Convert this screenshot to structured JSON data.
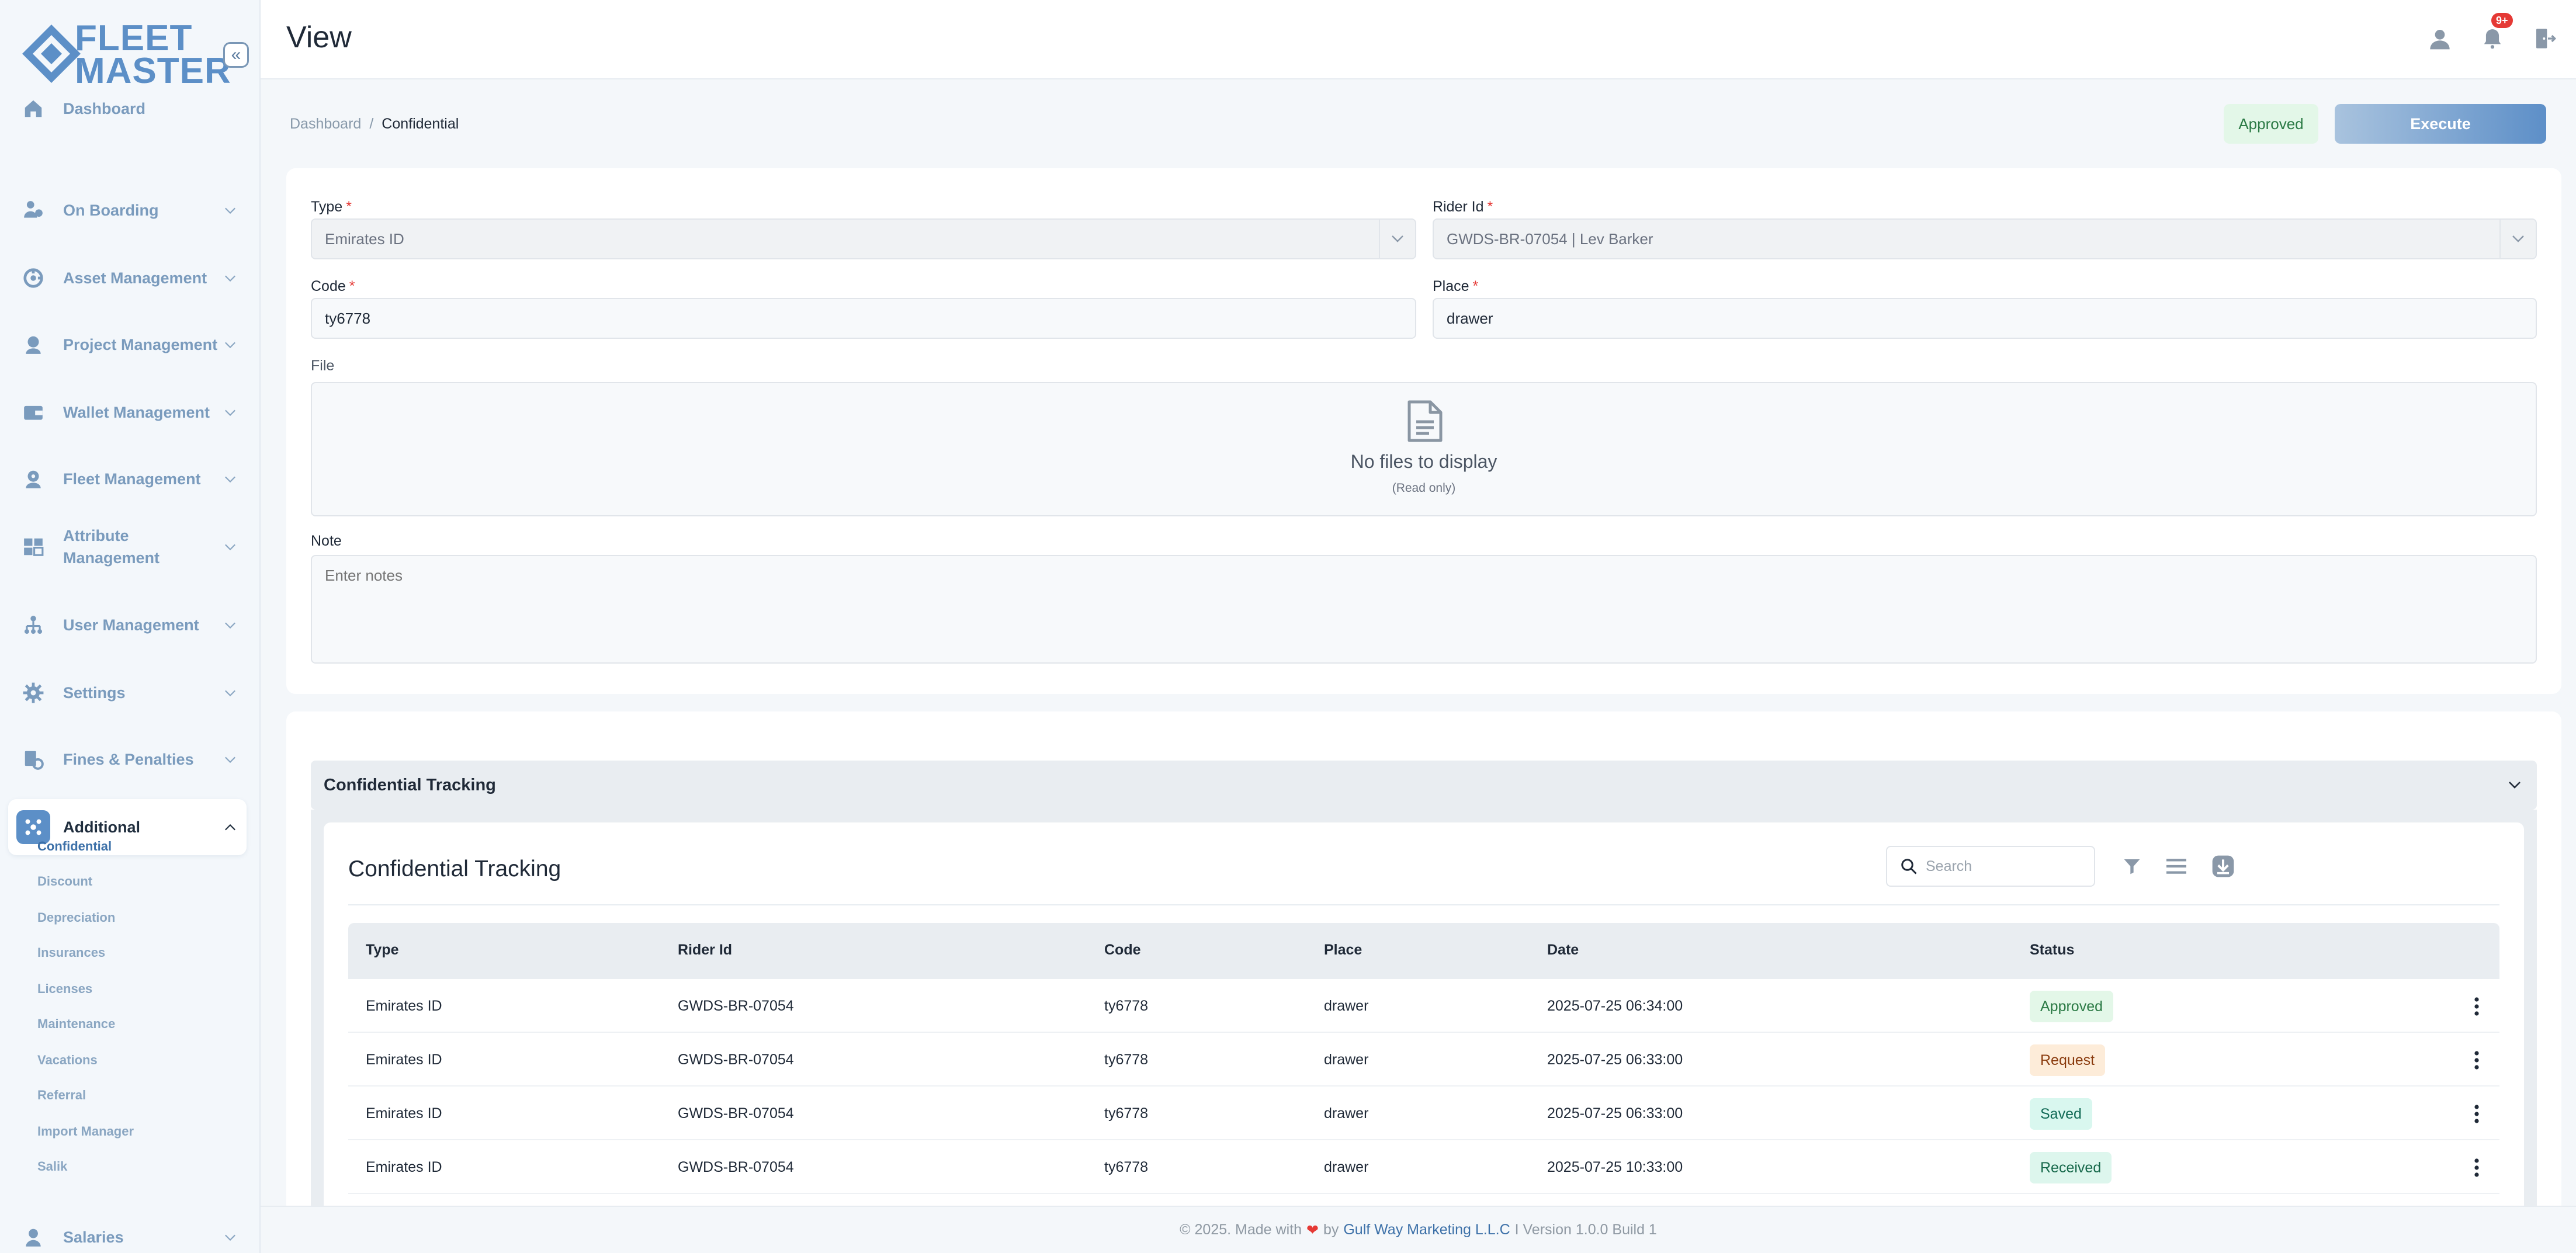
{
  "brand": {
    "line1": "FLEET",
    "line2": "MASTER",
    "color": "#5c8fc7"
  },
  "sidebar": {
    "items": [
      {
        "label": "Dashboard",
        "icon": "home-icon"
      },
      {
        "label": "On Boarding",
        "icon": "onboarding-icon"
      },
      {
        "label": "Asset Management",
        "icon": "asset-icon"
      },
      {
        "label": "Project Management",
        "icon": "project-icon"
      },
      {
        "label": "Wallet Management",
        "icon": "wallet-icon"
      },
      {
        "label": "Fleet Management",
        "icon": "fleet-icon"
      },
      {
        "label": "Attribute Management",
        "icon": "attribute-icon"
      },
      {
        "label": "User Management",
        "icon": "users-icon"
      },
      {
        "label": "Settings",
        "icon": "gear-icon"
      },
      {
        "label": "Fines & Penalties",
        "icon": "fines-icon"
      },
      {
        "label": "Additional",
        "icon": "additional-icon"
      },
      {
        "label": "Salaries",
        "icon": "salaries-icon"
      }
    ],
    "sub_items": [
      "Confidential",
      "Discount",
      "Depreciation",
      "Insurances",
      "Licenses",
      "Maintenance",
      "Vacations",
      "Referral",
      "Import Manager",
      "Salik"
    ]
  },
  "header": {
    "title": "View",
    "notifications": "9+"
  },
  "breadcrumb": {
    "root": "Dashboard",
    "sep": "/",
    "current": "Confidential"
  },
  "actions": {
    "status": "Approved",
    "execute": "Execute"
  },
  "form": {
    "type_label": "Type",
    "type_value": "Emirates ID",
    "rider_label": "Rider Id",
    "rider_value": "GWDS-BR-07054 | Lev Barker",
    "code_label": "Code",
    "code_value": "ty6778",
    "place_label": "Place",
    "place_value": "drawer",
    "file_label": "File",
    "file_empty": "No files to display",
    "file_readonly": "(Read only)",
    "note_label": "Note",
    "note_placeholder": "Enter notes",
    "required_mark": "*"
  },
  "tracking": {
    "accordion_title": "Confidential Tracking",
    "title": "Confidential Tracking",
    "search_placeholder": "Search",
    "columns": [
      "Type",
      "Rider Id",
      "Code",
      "Place",
      "Date",
      "Status"
    ],
    "rows": [
      {
        "type": "Emirates ID",
        "rider": "GWDS-BR-07054",
        "code": "ty6778",
        "place": "drawer",
        "date": "2025-07-25 06:34:00",
        "status": "Approved"
      },
      {
        "type": "Emirates ID",
        "rider": "GWDS-BR-07054",
        "code": "ty6778",
        "place": "drawer",
        "date": "2025-07-25 06:33:00",
        "status": "Request"
      },
      {
        "type": "Emirates ID",
        "rider": "GWDS-BR-07054",
        "code": "ty6778",
        "place": "drawer",
        "date": "2025-07-25 06:33:00",
        "status": "Saved"
      },
      {
        "type": "Emirates ID",
        "rider": "GWDS-BR-07054",
        "code": "ty6778",
        "place": "drawer",
        "date": "2025-07-25 10:33:00",
        "status": "Received"
      }
    ]
  },
  "footer": {
    "prefix": "© 2025. Made with",
    "by": "by",
    "company": "Gulf Way Marketing L.L.C",
    "version": "I Version 1.0.0 Build 1"
  }
}
